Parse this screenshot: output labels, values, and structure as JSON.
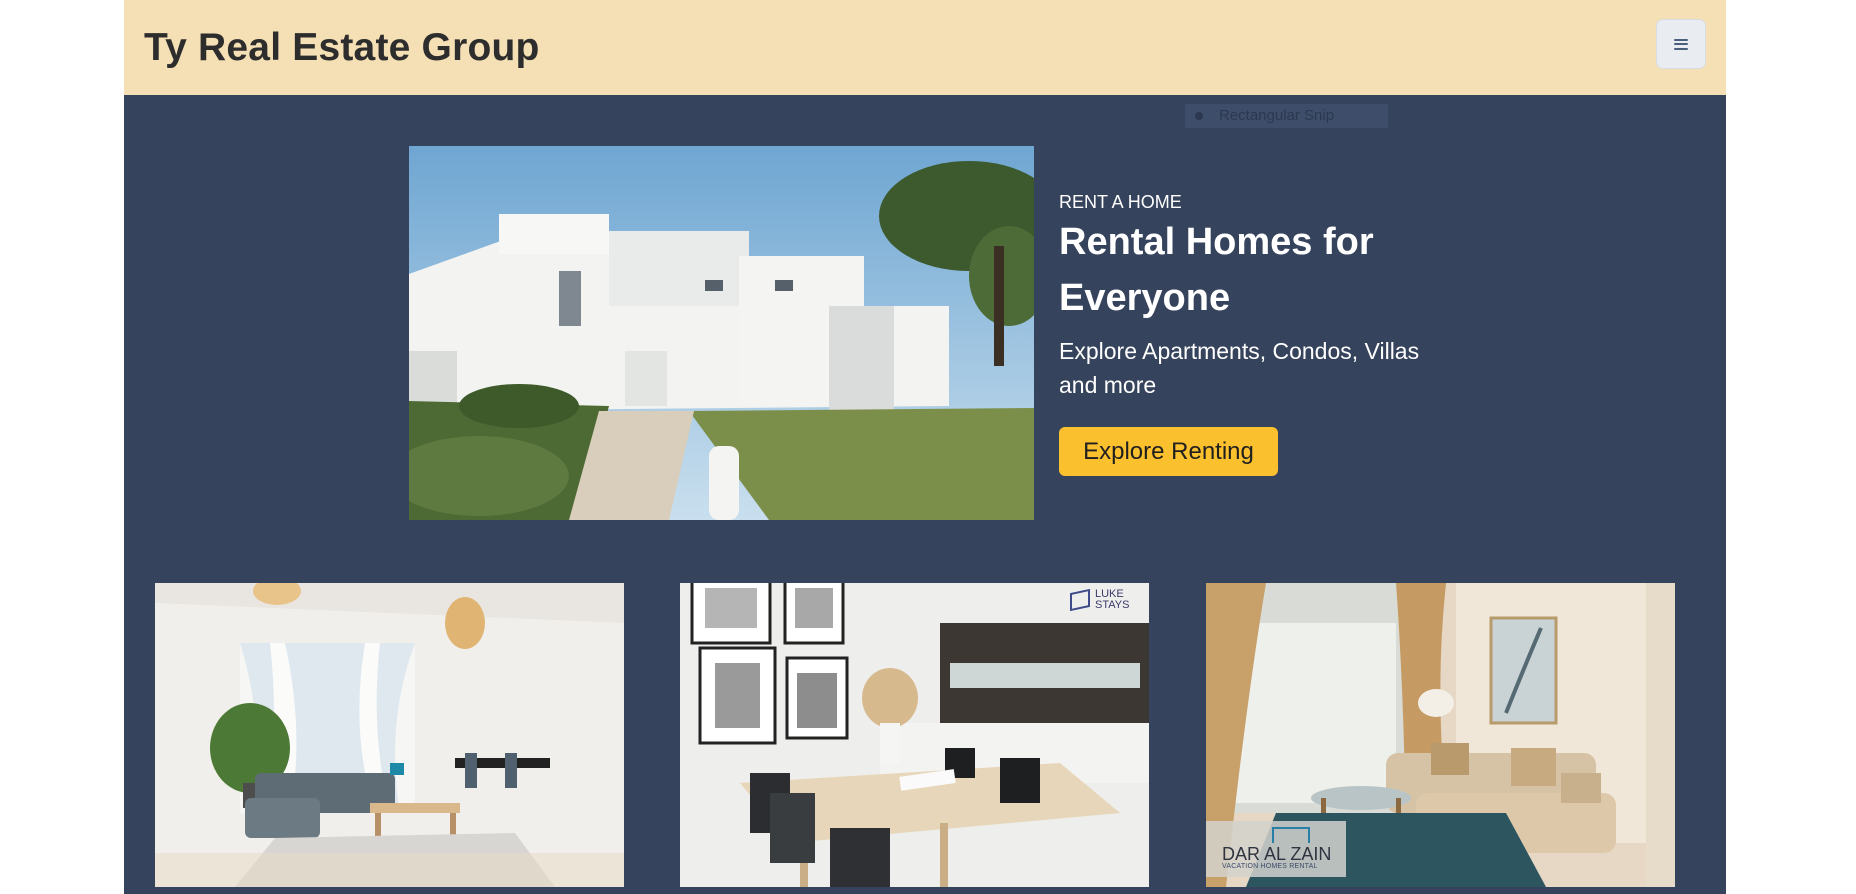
{
  "header": {
    "brand": "Ty Real Estate Group",
    "menu_icon": "hamburger-menu-icon"
  },
  "overlay": {
    "snip_label": "Rectangular Snip"
  },
  "hero": {
    "image_alt": "White modern villa with lawn and pine tree",
    "eyebrow": "RENT A HOME",
    "title": "Rental Homes for Everyone",
    "subtitle": "Explore Apartments, Condos, Villas and more",
    "cta_label": "Explore Renting"
  },
  "cards": [
    {
      "image_alt": "Bright living room with gray sectional sofa and dining table"
    },
    {
      "image_alt": "Dining area with wooden table and black chairs",
      "watermark": "LUKE STAYS"
    },
    {
      "image_alt": "Living room with beige sofa and glass coffee table",
      "watermark_name": "DAR AL ZAIN",
      "watermark_sub": "VACATION HOMES RENTAL"
    }
  ],
  "colors": {
    "header_bg": "#f5dfb4",
    "page_bg": "#36435c",
    "cta_bg": "#fbc02d",
    "text_light": "#ffffff"
  }
}
